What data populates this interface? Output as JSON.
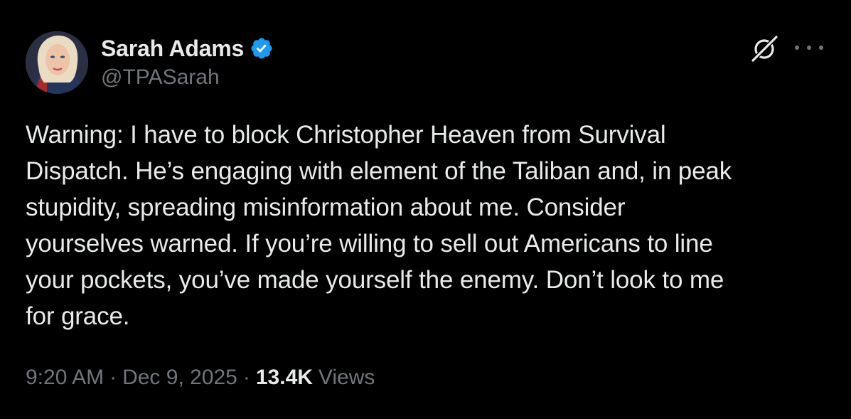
{
  "author": {
    "display_name": "Sarah Adams",
    "handle": "@TPASarah",
    "verified": true,
    "verified_color": "#1d9bf0"
  },
  "actions": {
    "grok_icon": "grok-icon",
    "more_icon": "more-horizontal-icon"
  },
  "tweet": {
    "lines": [
      "Warning: I have to block Christopher Heaven from Survival",
      "Dispatch. He’s engaging with element of the Taliban and, in peak",
      "stupidity, spreading misinformation about me. Consider",
      "yourselves warned. If you’re willing to sell out Americans to line",
      "your pockets, you’ve made yourself the enemy. Don’t look to me",
      "for grace."
    ]
  },
  "meta": {
    "time": "9:20 AM",
    "separator": "·",
    "date": "Dec 9, 2025",
    "views_count": "13.4K",
    "views_label": "Views"
  },
  "colors": {
    "background": "#000000",
    "primary_text": "#e7e9ea",
    "secondary_text": "#71767b",
    "accent": "#1d9bf0"
  }
}
